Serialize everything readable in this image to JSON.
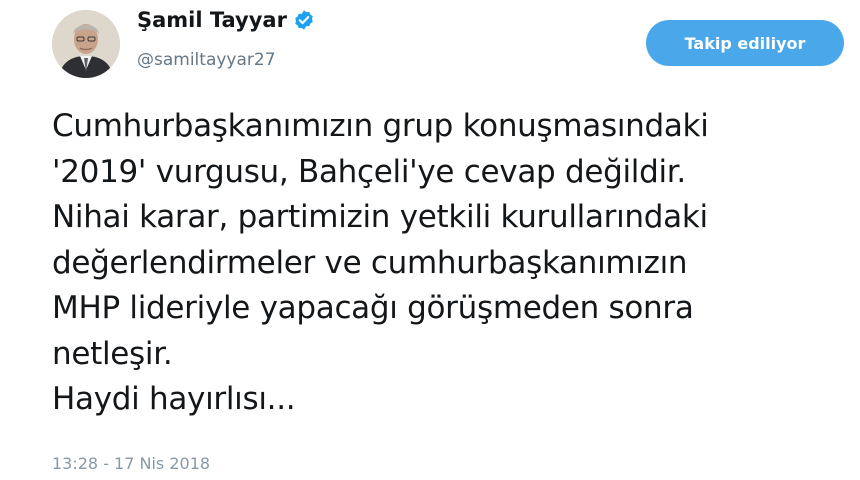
{
  "author": {
    "display_name": "Şamil Tayyar",
    "handle": "@samiltayyar27",
    "avatar_icon": "profile-photo",
    "verified_icon": "verified-badge-icon"
  },
  "follow_button": {
    "label": "Takip ediliyor"
  },
  "tweet": {
    "lines": [
      "Cumhurbaşkanımızın grup konuşmasındaki",
      "'2019' vurgusu, Bahçeli'ye cevap değildir.",
      "Nihai karar, partimizin yetkili kurullarındaki",
      "değerlendirmeler ve cumhurbaşkanımızın",
      "MHP lideriyle yapacağı görüşmeden sonra",
      "netleşir.",
      "Haydi hayırlısı..."
    ],
    "timestamp": "13:28 - 17 Nis 2018"
  },
  "colors": {
    "accent": "#1da1f2",
    "follow_button_bg": "#4aa8ea",
    "text": "#14171a",
    "muted": "#657786"
  }
}
